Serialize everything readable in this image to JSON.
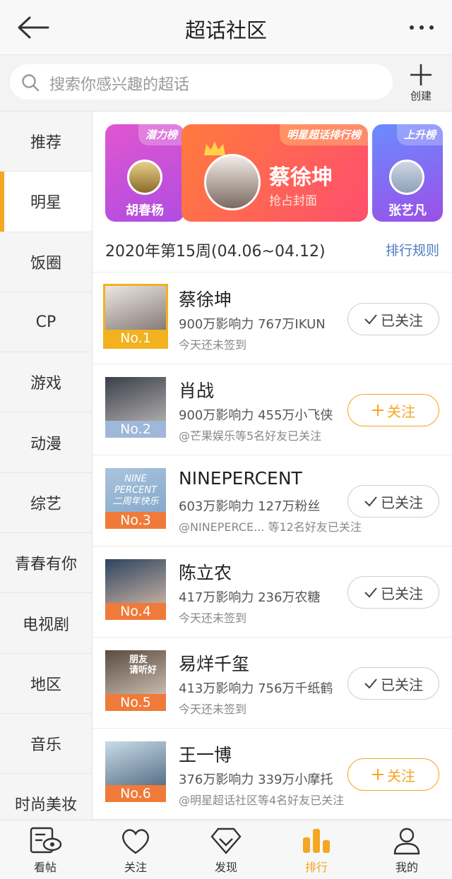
{
  "header": {
    "title": "超话社区"
  },
  "search": {
    "placeholder": "搜索你感兴趣的超话",
    "create_label": "创建"
  },
  "sidebar": {
    "items": [
      {
        "label": "推荐"
      },
      {
        "label": "明星"
      },
      {
        "label": "饭圈"
      },
      {
        "label": "CP"
      },
      {
        "label": "游戏"
      },
      {
        "label": "动漫"
      },
      {
        "label": "综艺"
      },
      {
        "label": "青春有你"
      },
      {
        "label": "电视剧"
      },
      {
        "label": "地区"
      },
      {
        "label": "音乐"
      },
      {
        "label": "时尚美妆"
      }
    ],
    "active_index": 1
  },
  "banner": {
    "left": {
      "tag": "潜力榜",
      "name": "胡春杨"
    },
    "center": {
      "tag": "明星超话排行榜",
      "name": "蔡徐坤",
      "sub": "抢占封面"
    },
    "right": {
      "tag": "上升榜",
      "name": "张艺凡"
    }
  },
  "week": {
    "label": "2020年第15周(04.06~04.12)",
    "rule_link": "排行规则"
  },
  "rankings": [
    {
      "rank": "No.1",
      "name": "蔡徐坤",
      "stats": "900万影响力 767万IKUN",
      "sub": "今天还未签到",
      "button": "已关注",
      "followed": true
    },
    {
      "rank": "No.2",
      "name": "肖战",
      "stats": "900万影响力 455万小飞侠",
      "sub": "@芒果娱乐等5名好友已关注",
      "button": "关注",
      "followed": false
    },
    {
      "rank": "No.3",
      "name": "NINEPERCENT",
      "stats": "603万影响力 127万粉丝",
      "sub": "@NINEPERCE...  等12名好友已关注",
      "button": "已关注",
      "followed": true
    },
    {
      "rank": "No.4",
      "name": "陈立农",
      "stats": "417万影响力 236万农糖",
      "sub": "今天还未签到",
      "button": "已关注",
      "followed": true
    },
    {
      "rank": "No.5",
      "name": "易烊千玺",
      "stats": "413万影响力 756万千纸鹤",
      "sub": "今天还未签到",
      "button": "已关注",
      "followed": true
    },
    {
      "rank": "No.6",
      "name": "王一博",
      "stats": "376万影响力 339万小摩托",
      "sub": "@明星超话社区等4名好友已关注",
      "button": "关注",
      "followed": false
    }
  ],
  "thumb_text": {
    "ninepercent_line1": "NINE",
    "ninepercent_line2": "PERCENT",
    "ninepercent_line3": "二周年快乐",
    "yiyang_line1": "朋友",
    "yiyang_line2": "请听好"
  },
  "tabbar": {
    "items": [
      {
        "label": "看帖",
        "icon": "eye-doc-icon"
      },
      {
        "label": "关注",
        "icon": "heart-icon"
      },
      {
        "label": "发现",
        "icon": "diamond-icon"
      },
      {
        "label": "排行",
        "icon": "bar-chart-icon"
      },
      {
        "label": "我的",
        "icon": "person-icon"
      }
    ],
    "active_index": 3
  },
  "colors": {
    "accent": "#f5a623",
    "link": "#4a7cc0",
    "gold_rank": "#f2b11e",
    "blue_rank": "#9fb7d8",
    "orange_rank": "#f07a3a"
  }
}
